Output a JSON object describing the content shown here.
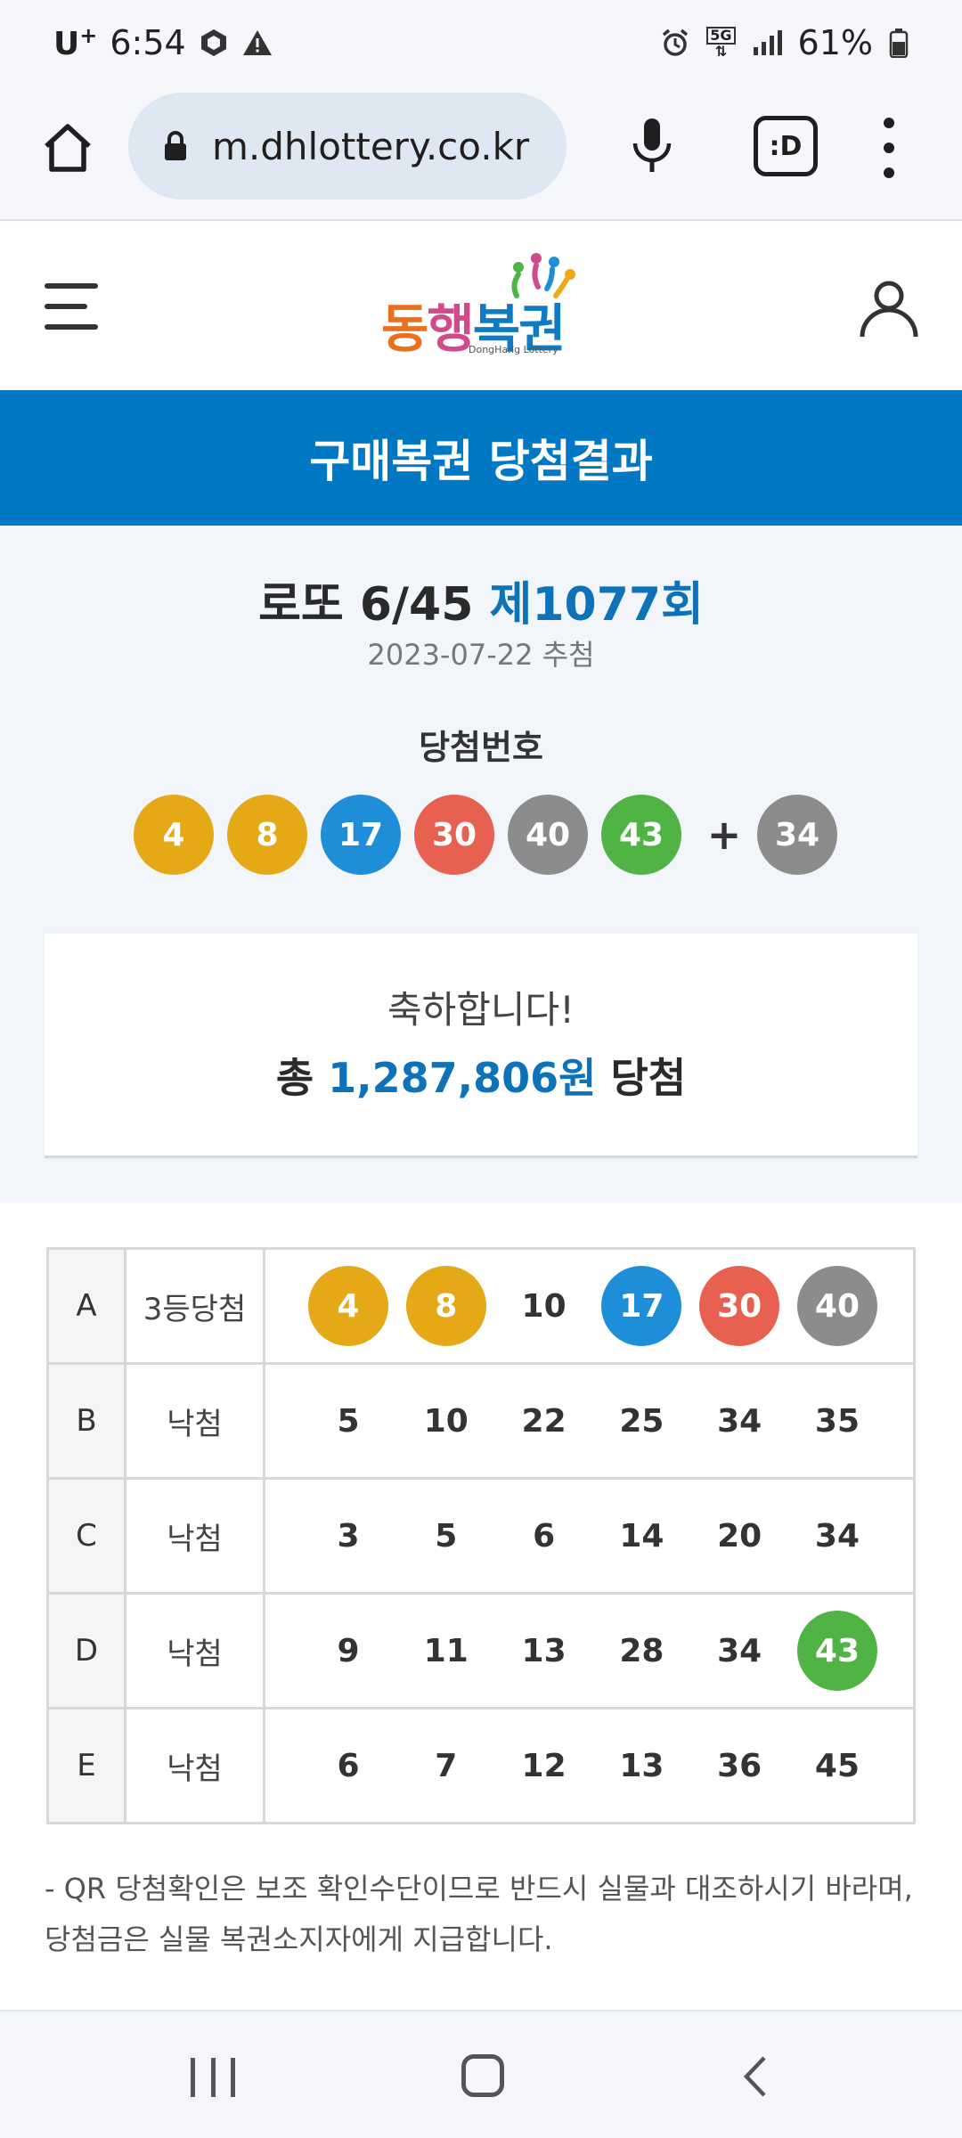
{
  "status_bar": {
    "carrier": "U",
    "carrier_sup": "+",
    "time": "6:54",
    "battery": "61%",
    "network": "5G"
  },
  "browser": {
    "url": "m.dhlottery.co.kr",
    "tab_label": ":D"
  },
  "header": {
    "logo_text_1": "동",
    "logo_text_2": "행",
    "logo_text_3": "복권",
    "logo_sub": "DongHang Lottery"
  },
  "banner": {
    "title": "구매복권 당첨결과"
  },
  "draw": {
    "title_prefix": "로또 6/45 ",
    "round": "제1077회",
    "date": "2023-07-22 추첨",
    "win_label": "당첨번호",
    "numbers": [
      4,
      8,
      17,
      30,
      40,
      43
    ],
    "bonus": 34,
    "plus": "+"
  },
  "result": {
    "congrats": "축하합니다!",
    "prize_prefix": "총 ",
    "prize_amount": "1,287,806원",
    "prize_suffix": " 당첨"
  },
  "tickets": [
    {
      "letter": "A",
      "result": "3등당첨",
      "numbers": [
        4,
        8,
        10,
        17,
        30,
        40
      ]
    },
    {
      "letter": "B",
      "result": "낙첨",
      "numbers": [
        5,
        10,
        22,
        25,
        34,
        35
      ]
    },
    {
      "letter": "C",
      "result": "낙첨",
      "numbers": [
        3,
        5,
        6,
        14,
        20,
        34
      ]
    },
    {
      "letter": "D",
      "result": "낙첨",
      "numbers": [
        9,
        11,
        13,
        28,
        34,
        43
      ]
    },
    {
      "letter": "E",
      "result": "낙첨",
      "numbers": [
        6,
        7,
        12,
        13,
        36,
        45
      ]
    }
  ],
  "notice": "- QR 당첨확인은 보조 확인수단이므로 반드시 실물과 대조하시기 바라며, 당첨금은 실물 복권소지자에게 지급합니다.",
  "colors": {
    "yellow": "#e5a816",
    "blue": "#1f8ed8",
    "red": "#e8604f",
    "gray": "#8c8c8c",
    "green": "#4fb443",
    "brand_blue": "#0078c3"
  },
  "icons": {
    "home": "home-icon",
    "lock": "lock-icon",
    "mic": "mic-icon",
    "more": "more-vertical-icon",
    "menu": "hamburger-menu-icon",
    "user": "user-icon",
    "alarm": "alarm-icon",
    "signal": "signal-icon",
    "battery": "battery-icon"
  }
}
